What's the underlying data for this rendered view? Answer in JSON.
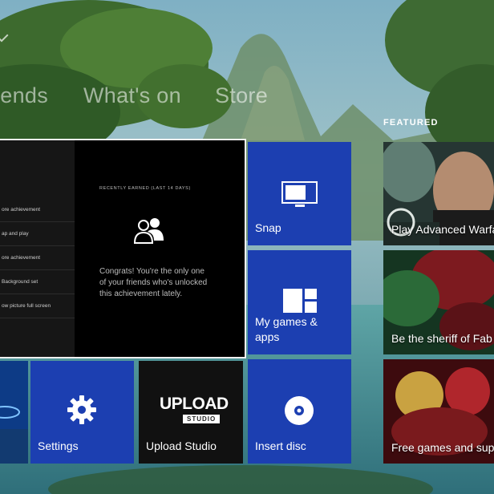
{
  "nav": {
    "tabs": [
      {
        "label": "iends"
      },
      {
        "label": "What's on"
      },
      {
        "label": "Store"
      }
    ]
  },
  "featured": {
    "heading": "FEATURED",
    "items": [
      {
        "label": "Play Advanced Warfare"
      },
      {
        "label": "Be the sheriff of Fab"
      },
      {
        "label": "Free games and sup"
      }
    ]
  },
  "achievement_panel": {
    "list": [
      "ore achievement",
      "ap and play",
      "ore achievement",
      "Background set",
      "ow picture full screen"
    ],
    "heading": "RECENTLY EARNED (LAST 14 DAYS)",
    "message": "Congrats! You're the only one of your friends who's unlocked this achievement lately."
  },
  "tiles": {
    "snap": {
      "label": "Snap"
    },
    "my_games": {
      "label": "My games & apps"
    },
    "settings": {
      "label": "Settings"
    },
    "upload_studio": {
      "label": "Upload Studio",
      "logo": "UPLOAD",
      "badge": "STUDIO"
    },
    "insert_disc": {
      "label": "Insert disc"
    }
  },
  "colors": {
    "tile_blue": "#1c3fb1",
    "panel_bg": "#000000",
    "panel_border": "#f0f0f0"
  },
  "icons": [
    "chevron-icon",
    "snap-icon",
    "grid-icon",
    "friends-icon",
    "gear-icon",
    "disc-icon"
  ]
}
